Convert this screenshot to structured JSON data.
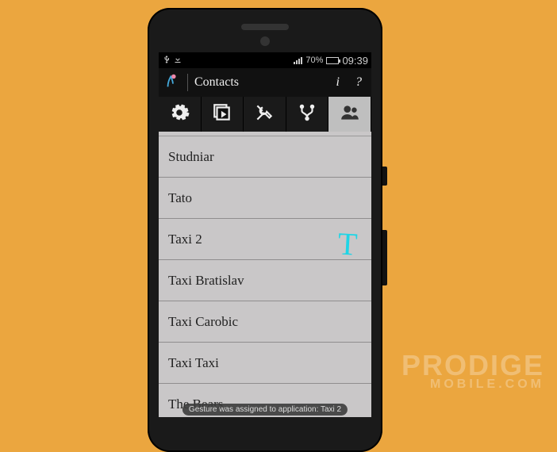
{
  "statusbar": {
    "battery_pct": "70%",
    "time": "09:39"
  },
  "appbar": {
    "title": "Contacts",
    "info": "i",
    "help": "?"
  },
  "contacts": {
    "items": [
      {
        "name": "Studniar"
      },
      {
        "name": "Tato"
      },
      {
        "name": "Taxi 2"
      },
      {
        "name": "Taxi Bratislav"
      },
      {
        "name": "Taxi Carobic"
      },
      {
        "name": "Taxi Taxi"
      },
      {
        "name": "The Bears"
      }
    ]
  },
  "gesture": {
    "letter": "T",
    "toast": "Gesture was assigned to application: Taxi 2"
  },
  "watermark": {
    "line1": "PRODIGE",
    "line2": "MOBILE.COM"
  }
}
